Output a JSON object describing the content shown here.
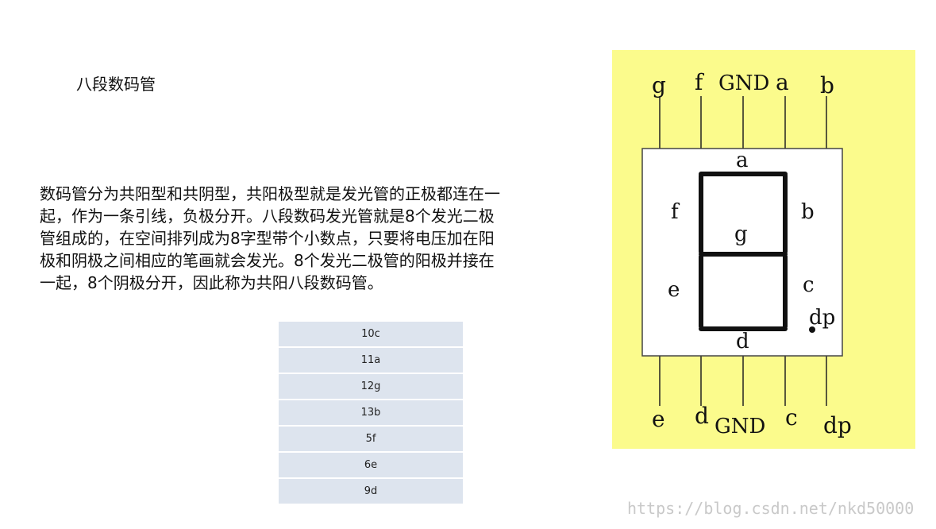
{
  "title": "八段数码管",
  "paragraph": "数码管分为共阳型和共阴型，共阳极型就是发光管的正极都连在一起，作为一条引线，负极分开。八段数码发光管就是8个发光二极管组成的，在空间排列成为8字型带个小数点，只要将电压加在阳极和阴极之间相应的笔画就会发光。8个发光二极管的阳极并接在一起，8个阴极分开，因此称为共阳八段数码管。",
  "pin_table": [
    "10c",
    "11a",
    "12g",
    "13b",
    "5f",
    "6e",
    "9d"
  ],
  "diagram": {
    "background_color": "#fbfb8c",
    "top_pins": [
      "g",
      "f",
      "GND",
      "a",
      "b"
    ],
    "bottom_pins": [
      "e",
      "d",
      "GND",
      "c",
      "dp"
    ],
    "segment_labels": {
      "a": "a",
      "b": "b",
      "c": "c",
      "d": "d",
      "e": "e",
      "f": "f",
      "g": "g",
      "dp": "dp"
    }
  },
  "watermark": "https://blog.csdn.net/nkd50000"
}
